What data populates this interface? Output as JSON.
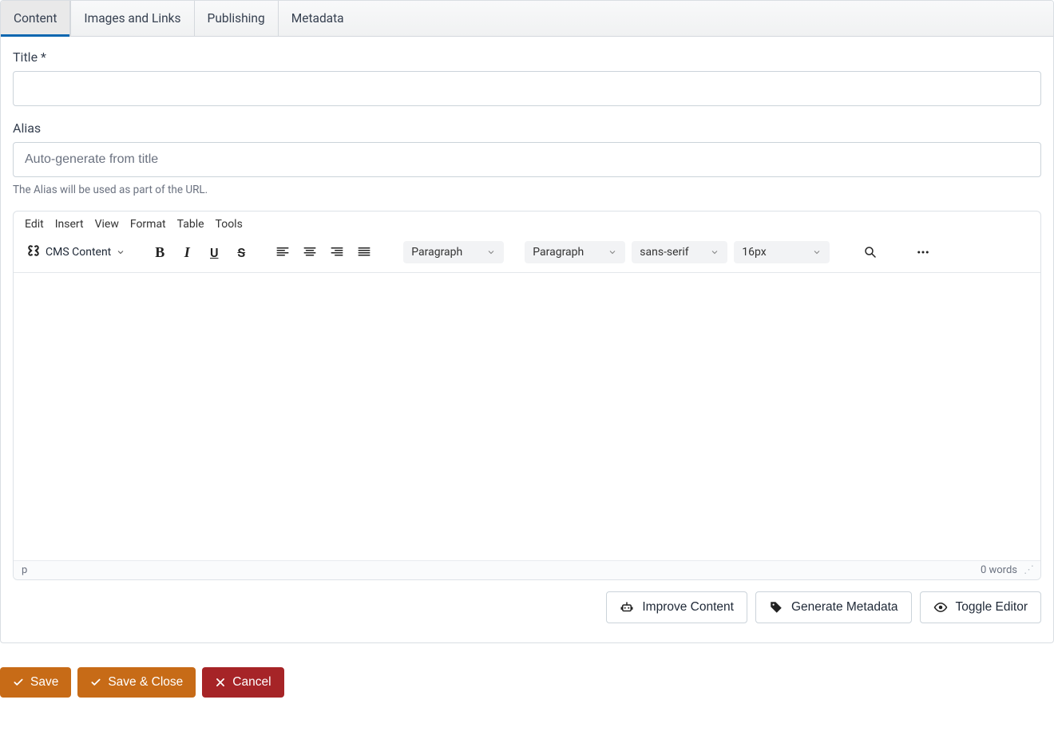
{
  "tabs": [
    "Content",
    "Images and Links",
    "Publishing",
    "Metadata"
  ],
  "activeTabIndex": 0,
  "fields": {
    "title": {
      "label": "Title *",
      "value": ""
    },
    "alias": {
      "label": "Alias",
      "placeholder": "Auto-generate from title",
      "value": "",
      "help": "The Alias will be used as part of the URL."
    }
  },
  "editor": {
    "menubar": [
      "Edit",
      "Insert",
      "View",
      "Format",
      "Table",
      "Tools"
    ],
    "cms_label": "CMS Content",
    "block_format": "Paragraph",
    "style_format": "Paragraph",
    "font_family": "sans-serif",
    "font_size": "16px",
    "status_path": "p",
    "word_count": "0 words",
    "buttons": {
      "improve": "Improve Content",
      "generate_meta": "Generate Metadata",
      "toggle_editor": "Toggle Editor"
    }
  },
  "actions": {
    "save": "Save",
    "save_close": "Save & Close",
    "cancel": "Cancel"
  }
}
